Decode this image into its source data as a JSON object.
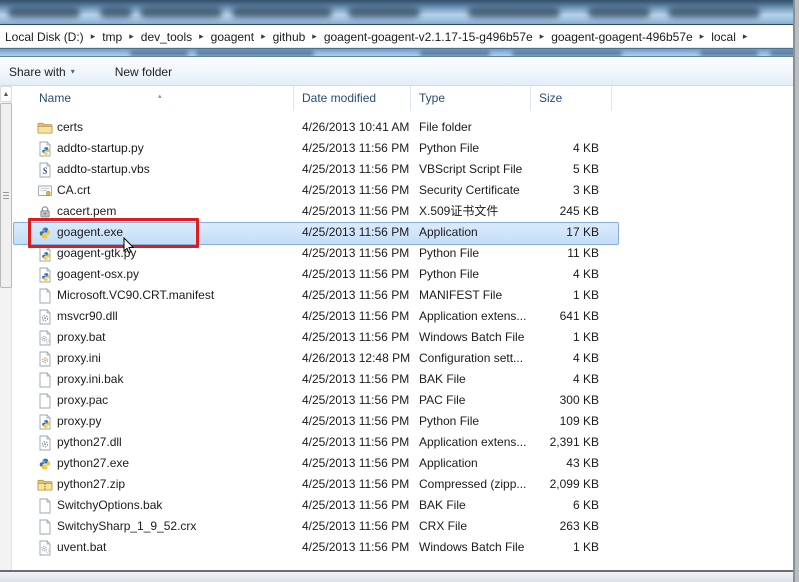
{
  "breadcrumb": {
    "items": [
      "Local Disk (D:)",
      "tmp",
      "dev_tools",
      "goagent",
      "github",
      "goagent-goagent-v2.1.17-15-g496b57e",
      "goagent-goagent-496b57e",
      "local"
    ],
    "separator": "▸"
  },
  "toolbar": {
    "share_with_label": "Share with",
    "new_folder_label": "New folder"
  },
  "columns": {
    "name": "Name",
    "date_modified": "Date modified",
    "type": "Type",
    "size": "Size",
    "sort_glyph": "▴"
  },
  "scrollbar": {
    "up_glyph": "▲"
  },
  "files": [
    {
      "name": "certs",
      "icon": "folder",
      "date": "4/26/2013 10:41 AM",
      "type": "File folder",
      "size": ""
    },
    {
      "name": "addto-startup.py",
      "icon": "python-file",
      "date": "4/25/2013 11:56 PM",
      "type": "Python File",
      "size": "4 KB"
    },
    {
      "name": "addto-startup.vbs",
      "icon": "vbscript",
      "date": "4/25/2013 11:56 PM",
      "type": "VBScript Script File",
      "size": "5 KB"
    },
    {
      "name": "CA.crt",
      "icon": "certificate",
      "date": "4/25/2013 11:56 PM",
      "type": "Security Certificate",
      "size": "3 KB"
    },
    {
      "name": "cacert.pem",
      "icon": "lock",
      "date": "4/25/2013 11:56 PM",
      "type": "X.509证书文件",
      "size": "245 KB"
    },
    {
      "name": "goagent.exe",
      "icon": "python-app",
      "date": "4/25/2013 11:56 PM",
      "type": "Application",
      "size": "17 KB",
      "selected": true,
      "annotated": true
    },
    {
      "name": "goagent-gtk.py",
      "icon": "python-file",
      "date": "4/25/2013 11:56 PM",
      "type": "Python File",
      "size": "11 KB"
    },
    {
      "name": "goagent-osx.py",
      "icon": "python-file",
      "date": "4/25/2013 11:56 PM",
      "type": "Python File",
      "size": "4 KB"
    },
    {
      "name": "Microsoft.VC90.CRT.manifest",
      "icon": "file",
      "date": "4/25/2013 11:56 PM",
      "type": "MANIFEST File",
      "size": "1 KB"
    },
    {
      "name": "msvcr90.dll",
      "icon": "dll",
      "date": "4/25/2013 11:56 PM",
      "type": "Application extens...",
      "size": "641 KB"
    },
    {
      "name": "proxy.bat",
      "icon": "batch",
      "date": "4/25/2013 11:56 PM",
      "type": "Windows Batch File",
      "size": "1 KB"
    },
    {
      "name": "proxy.ini",
      "icon": "ini",
      "date": "4/26/2013 12:48 PM",
      "type": "Configuration sett...",
      "size": "4 KB"
    },
    {
      "name": "proxy.ini.bak",
      "icon": "file",
      "date": "4/25/2013 11:56 PM",
      "type": "BAK File",
      "size": "4 KB"
    },
    {
      "name": "proxy.pac",
      "icon": "file",
      "date": "4/25/2013 11:56 PM",
      "type": "PAC File",
      "size": "300 KB"
    },
    {
      "name": "proxy.py",
      "icon": "python-file",
      "date": "4/25/2013 11:56 PM",
      "type": "Python File",
      "size": "109 KB"
    },
    {
      "name": "python27.dll",
      "icon": "dll",
      "date": "4/25/2013 11:56 PM",
      "type": "Application extens...",
      "size": "2,391 KB"
    },
    {
      "name": "python27.exe",
      "icon": "python-app",
      "date": "4/25/2013 11:56 PM",
      "type": "Application",
      "size": "43 KB"
    },
    {
      "name": "python27.zip",
      "icon": "zip",
      "date": "4/25/2013 11:56 PM",
      "type": "Compressed (zipp...",
      "size": "2,099 KB"
    },
    {
      "name": "SwitchyOptions.bak",
      "icon": "file",
      "date": "4/25/2013 11:56 PM",
      "type": "BAK File",
      "size": "6 KB"
    },
    {
      "name": "SwitchySharp_1_9_52.crx",
      "icon": "file",
      "date": "4/25/2013 11:56 PM",
      "type": "CRX File",
      "size": "263 KB"
    },
    {
      "name": "uvent.bat",
      "icon": "batch",
      "date": "4/25/2013 11:56 PM",
      "type": "Windows Batch File",
      "size": "1 KB"
    }
  ],
  "colors": {
    "selection_border": "#84acdd",
    "selection_fill": "#cde3f8",
    "annotation_red": "#e01b1b",
    "folder_yellow": "#f5d98b",
    "python_blue": "#3973a6",
    "python_yellow": "#f4c73e",
    "titlebar_blue": "#7ea3c4"
  }
}
